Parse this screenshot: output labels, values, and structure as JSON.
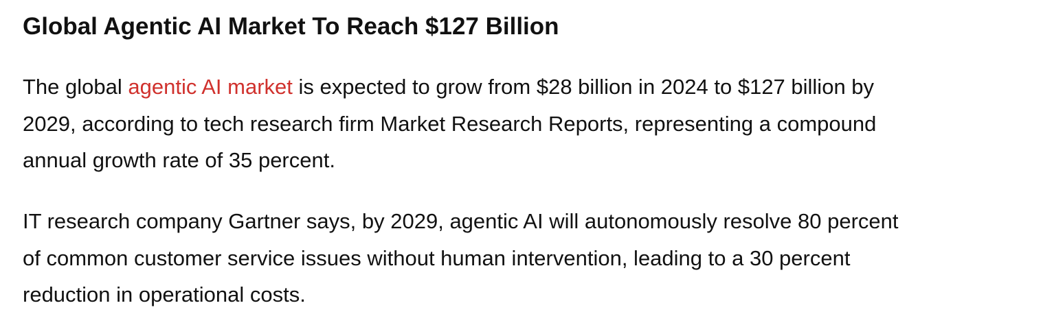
{
  "article": {
    "headline": "Global Agentic AI Market To Reach $127 Billion",
    "paragraph_1": {
      "line_1_before_link": "The global ",
      "link_text": "agentic AI market",
      "line_1_after_link": " is expected to grow from $28 billion in 2024 to $127 billion by",
      "line_2": "2029, according to tech research firm Market Research Reports, representing a compound",
      "line_3": "annual growth rate of 35 percent."
    },
    "paragraph_2": {
      "line_1": "IT research company Gartner says, by 2029, agentic AI will autonomously resolve 80 percent",
      "line_2": "of common customer service issues without human intervention, leading to a 30 percent",
      "line_3": "reduction in operational costs."
    }
  },
  "colors": {
    "text": "#111111",
    "link": "#d0312d",
    "background": "#ffffff"
  }
}
